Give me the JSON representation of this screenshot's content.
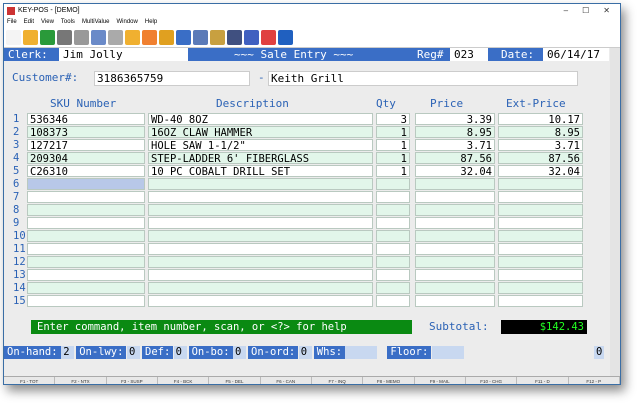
{
  "window": {
    "title": "KEY-POS - [DEMO]",
    "controls": [
      "–",
      "☐",
      "✕"
    ]
  },
  "menu": [
    "File",
    "Edit",
    "View",
    "Tools",
    "MultiValue",
    "Window",
    "Help"
  ],
  "toolbar": [
    "new-icon",
    "open-icon",
    "save-icon",
    "print-icon",
    "barcode-icon",
    "copy-icon",
    "paste-icon",
    "folder-icon",
    "folder-export-icon",
    "database-icon",
    "list-icon",
    "report-icon",
    "settings-icon",
    "connect-icon",
    "edit-icon",
    "action-icon",
    "help-icon"
  ],
  "header": {
    "clerk_label": "Clerk:",
    "clerk": "Jim Jolly",
    "title": "~~~ Sale Entry ~~~",
    "reg_label": "Reg#",
    "reg": "023",
    "date_label": "Date:",
    "date": "06/14/17"
  },
  "customer": {
    "label": "Customer#:",
    "number": "3186365759",
    "sep": "-",
    "name": "Keith Grill"
  },
  "columns": {
    "sku": "SKU Number",
    "desc": "Description",
    "qty": "Qty",
    "price": "Price",
    "ext": "Ext-Price"
  },
  "rows": [
    {
      "n": "1",
      "sku": "536346",
      "desc": "WD-40 8OZ",
      "qty": "3",
      "price": "3.39",
      "ext": "10.17"
    },
    {
      "n": "2",
      "sku": "108373",
      "desc": "16OZ CLAW HAMMER",
      "qty": "1",
      "price": "8.95",
      "ext": "8.95"
    },
    {
      "n": "3",
      "sku": "127217",
      "desc": "HOLE SAW 1-1/2\"",
      "qty": "1",
      "price": "3.71",
      "ext": "3.71"
    },
    {
      "n": "4",
      "sku": "209304",
      "desc": "STEP-LADDER 6' FIBERGLASS",
      "qty": "1",
      "price": "87.56",
      "ext": "87.56"
    },
    {
      "n": "5",
      "sku": "C26310",
      "desc": "10 PC COBALT DRILL SET",
      "qty": "1",
      "price": "32.04",
      "ext": "32.04"
    },
    {
      "n": "6",
      "sku": "_",
      "desc": "",
      "qty": "",
      "price": "",
      "ext": ""
    },
    {
      "n": "7",
      "sku": "",
      "desc": "",
      "qty": "",
      "price": "",
      "ext": ""
    },
    {
      "n": "8",
      "sku": "",
      "desc": "",
      "qty": "",
      "price": "",
      "ext": ""
    },
    {
      "n": "9",
      "sku": "",
      "desc": "",
      "qty": "",
      "price": "",
      "ext": ""
    },
    {
      "n": "10",
      "sku": "",
      "desc": "",
      "qty": "",
      "price": "",
      "ext": ""
    },
    {
      "n": "11",
      "sku": "",
      "desc": "",
      "qty": "",
      "price": "",
      "ext": ""
    },
    {
      "n": "12",
      "sku": "",
      "desc": "",
      "qty": "",
      "price": "",
      "ext": ""
    },
    {
      "n": "13",
      "sku": "",
      "desc": "",
      "qty": "",
      "price": "",
      "ext": ""
    },
    {
      "n": "14",
      "sku": "",
      "desc": "",
      "qty": "",
      "price": "",
      "ext": ""
    },
    {
      "n": "15",
      "sku": "",
      "desc": "",
      "qty": "",
      "price": "",
      "ext": ""
    }
  ],
  "status": "Enter command, item number, scan, or <?> for help",
  "subtotal_label": "Subtotal:",
  "subtotal": "$142.43",
  "info": [
    {
      "label": "On-hand:",
      "value": "2"
    },
    {
      "label": "On-lwy:",
      "value": "0"
    },
    {
      "label": "Def:",
      "value": "0"
    },
    {
      "label": "On-bo:",
      "value": "0"
    },
    {
      "label": "On-ord:",
      "value": "0"
    },
    {
      "label": "Whs:",
      "value": ""
    },
    {
      "label": "Floor:",
      "value": ""
    }
  ],
  "counter": "0",
  "fkeys": [
    "F1 - TOT",
    "F2 - NTX",
    "F3 - SUSP",
    "F4 - BCK",
    "F5 - DEL",
    "F6 - CAN",
    "F7 - INQ",
    "F8 - MEMO",
    "F9 - MAIL",
    "F10 - CHG",
    "F11 - D",
    "F12 - P"
  ]
}
